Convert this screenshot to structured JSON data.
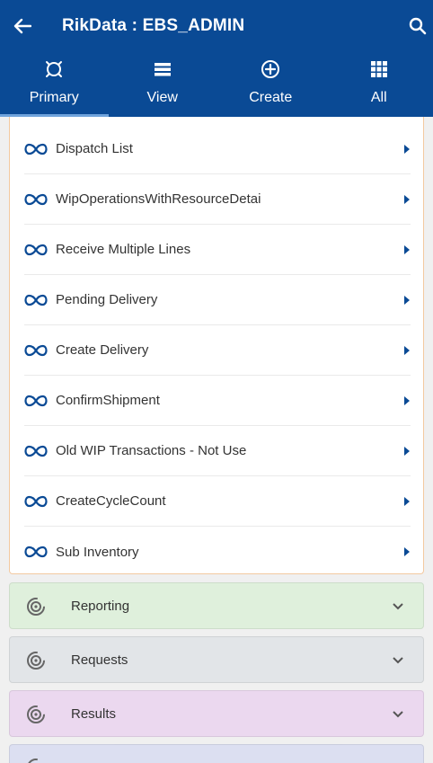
{
  "header": {
    "title": "RikData : EBS_ADMIN",
    "back_icon": "arrow-left-icon",
    "search_icon": "search-icon",
    "background": "#0a4a95"
  },
  "tabs": [
    {
      "label": "Primary",
      "icon": "target-icon",
      "active": true
    },
    {
      "label": "View",
      "icon": "list-icon",
      "active": false
    },
    {
      "label": "Create",
      "icon": "plus-circle-icon",
      "active": false
    },
    {
      "label": "All",
      "icon": "grid-icon",
      "active": false
    }
  ],
  "primary_items": [
    {
      "label": "Dispatch List"
    },
    {
      "label": "WipOperationsWithResourceDetai"
    },
    {
      "label": "Receive Multiple Lines"
    },
    {
      "label": "Pending Delivery"
    },
    {
      "label": "Create Delivery"
    },
    {
      "label": "ConfirmShipment"
    },
    {
      "label": "Old WIP Transactions - Not Use"
    },
    {
      "label": "CreateCycleCount"
    },
    {
      "label": "Sub Inventory"
    }
  ],
  "sections": [
    {
      "label": "Reporting",
      "color": "#dff0dc"
    },
    {
      "label": "Requests",
      "color": "#e2e5e8"
    },
    {
      "label": "Results",
      "color": "#ebd8ef"
    },
    {
      "label": "",
      "color": "#dcdff1"
    }
  ]
}
